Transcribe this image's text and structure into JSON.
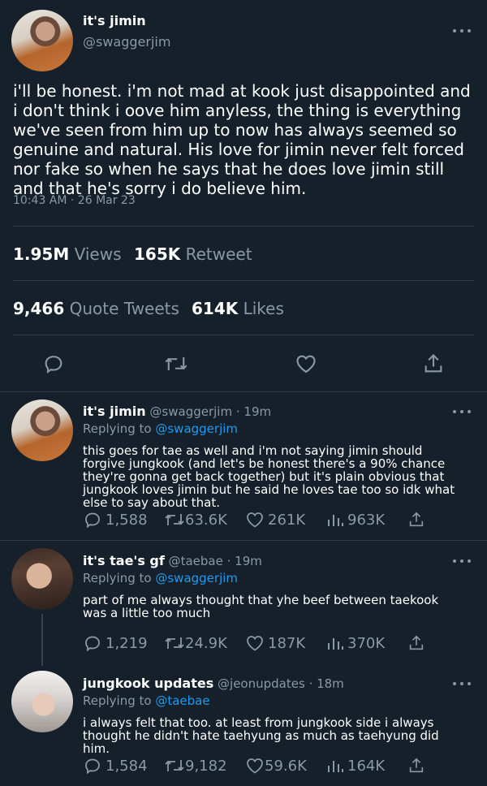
{
  "main_tweet": {
    "display_name": "it's jimin",
    "handle": "@swaggerjim",
    "text": "i'll be honest. i'm not mad at kook just disappointed and i don't think i oove him anyless, the thing is everything we've seen from him up to now has always seemed so genuine and natural. His love for jimin never felt forced nor fake so when he says that he does love jimin still and that he's sorry i do believe him.",
    "timestamp": "10:43 AM · 26 Mar 23",
    "views_count": "1.95M",
    "views_label": "Views",
    "retweets_count": "165K",
    "retweets_label": "Retweet",
    "quotes_count": "9,466",
    "quotes_label": "Quote Tweets",
    "likes_count": "614K",
    "likes_label": "Likes"
  },
  "replies": [
    {
      "display_name": "it's jimin",
      "handle": "@swaggerjim",
      "time": "· 19m",
      "replying_prefix": "Replying to",
      "replying_to": "@swaggerjim",
      "text": "this goes for tae as well and i'm not saying jimin should forgive jungkook (and let's be honest there's a 90% chance they're gonna get back together) but it's plain obvious that jungkook loves jimin but he said he loves tae too so idk what else to say about that.",
      "replies": "1,588",
      "retweets": "63.6K",
      "likes": "261K",
      "views": "963K"
    },
    {
      "display_name": "it's tae's gf",
      "handle": "@taebae",
      "time": "· 19m",
      "replying_prefix": "Replying to",
      "replying_to": "@swaggerjim",
      "text": "part of me always thought that yhe beef between taekook was a little too much",
      "replies": "1,219",
      "retweets": "24.9K",
      "likes": "187K",
      "views": "370K"
    },
    {
      "display_name": "jungkook updates",
      "handle": "@jeonupdates",
      "time": "· 18m",
      "replying_prefix": "Replying to",
      "replying_to": "@taebae",
      "text": "i always felt that too. at least from jungkook side i always thought he didn't hate taehyung as much as taehyung did him.",
      "replies": "1,584",
      "retweets": "9,182",
      "likes": "59.6K",
      "views": "164K"
    }
  ],
  "icons": [
    "reply-icon",
    "retweet-icon",
    "like-icon",
    "share-icon",
    "views-icon",
    "more-icon"
  ],
  "colors": {
    "background": "#15202b",
    "accent": "#1d9bf0",
    "muted": "#8b98a5",
    "divider": "#2f3b47"
  }
}
